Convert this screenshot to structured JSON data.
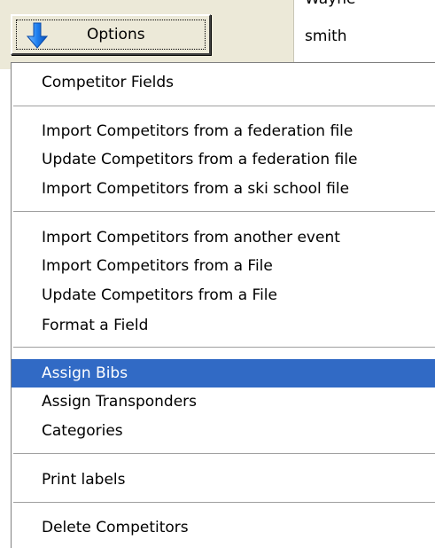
{
  "grid": {
    "cell_above": "Wayne",
    "cell_current": "smith"
  },
  "button": {
    "label": "Options",
    "icon": "blue-down-arrow-icon",
    "icon_color": "#1e7ff0"
  },
  "menu": {
    "highlight_color": "#316ac5",
    "items": [
      {
        "label": "Competitor Fields"
      },
      {
        "label": "Import Competitors from a federation file"
      },
      {
        "label": "Update Competitors from a federation file"
      },
      {
        "label": "Import Competitors from a ski school file"
      },
      {
        "label": "Import Competitors from another event"
      },
      {
        "label": "Import Competitors from a File"
      },
      {
        "label": "Update Competitors from a File"
      },
      {
        "label": "Format a Field"
      },
      {
        "label": "Assign Bibs",
        "selected": true
      },
      {
        "label": "Assign Transponders"
      },
      {
        "label": "Categories"
      },
      {
        "label": "Print labels"
      },
      {
        "label": "Delete Competitors"
      }
    ]
  }
}
